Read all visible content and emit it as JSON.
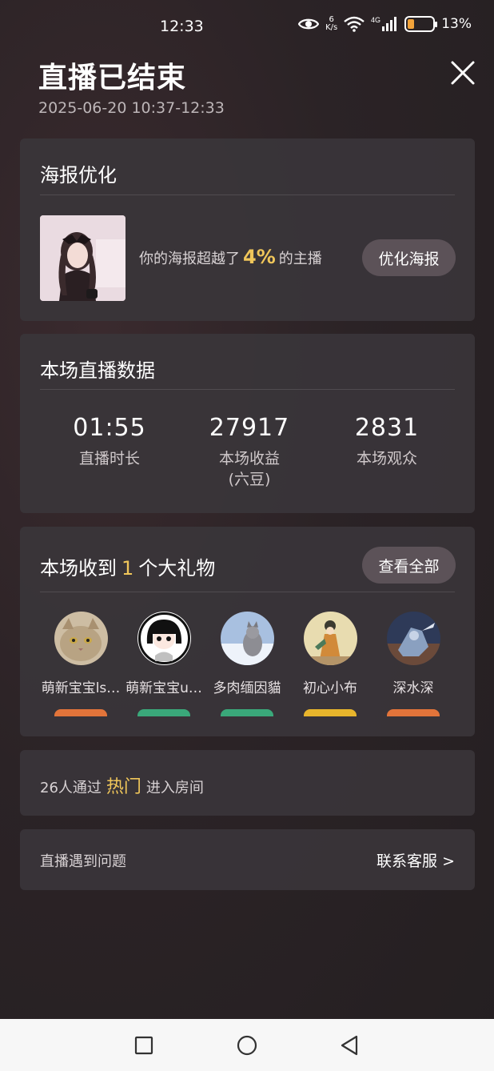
{
  "status_bar": {
    "time": "12:33",
    "net_speed_value": "6",
    "net_speed_unit": "K/s",
    "network": "4G",
    "battery_percent": "13%",
    "battery_level": 0.13
  },
  "header": {
    "title": "直播已结束",
    "time_range": "2025-06-20 10:37-12:33"
  },
  "poster": {
    "title": "海报优化",
    "text_before": "你的海报超越了",
    "percent": "4%",
    "text_after": "的主播",
    "button": "优化海报"
  },
  "stats": {
    "title": "本场直播数据",
    "items": [
      {
        "value": "01:55",
        "label": "直播时长",
        "sub": ""
      },
      {
        "value": "27917",
        "label": "本场收益",
        "sub": "(六豆)"
      },
      {
        "value": "2831",
        "label": "本场观众",
        "sub": ""
      }
    ]
  },
  "gifts": {
    "title_before": "本场收到",
    "count": "1",
    "title_after": "个大礼物",
    "view_all": "查看全部",
    "gifters": [
      {
        "name": "萌新宝宝ls…",
        "badge_color": "#e2743a"
      },
      {
        "name": "萌新宝宝u…",
        "badge_color": "#3aa87a"
      },
      {
        "name": "多肉缅因貓",
        "badge_color": "#3aa87a"
      },
      {
        "name": "初心小布",
        "badge_color": "#e8b52c"
      },
      {
        "name": "深水深",
        "badge_color": "#e2743a"
      }
    ]
  },
  "hot": {
    "text_before": "26人通过",
    "keyword": "热门",
    "text_after": "进入房间"
  },
  "help": {
    "text": "直播遇到问题",
    "link": "联系客服 >"
  }
}
